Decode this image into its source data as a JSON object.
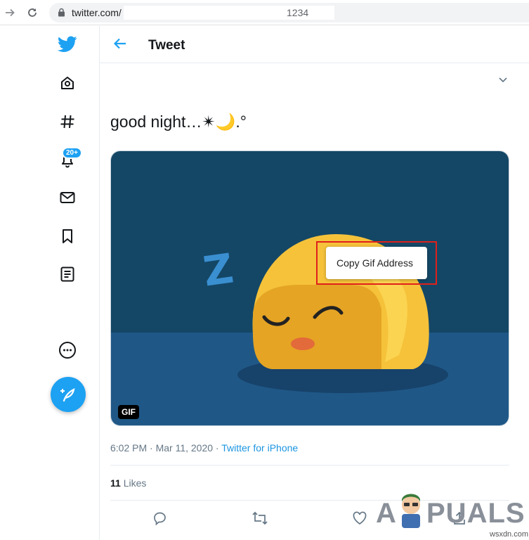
{
  "browser": {
    "url": "twitter.com/",
    "url_suffix": "1234"
  },
  "sidebar": {
    "notifications_badge": "20+"
  },
  "header": {
    "title": "Tweet"
  },
  "tweet": {
    "text": "good night…✴🌙.°",
    "gif_badge": "GIF",
    "time": "6:02 PM · Mar 11, 2020 · ",
    "source": "Twitter for iPhone",
    "likes_count": "11",
    "likes_label": "Likes"
  },
  "context_menu": {
    "item": "Copy Gif Address"
  },
  "gif_art": {
    "sleep_letter": "Z"
  },
  "watermark": {
    "brand_a": "A",
    "brand_rest": "PUALS",
    "site": "wsxdn.com"
  },
  "colors": {
    "accent": "#1da1f2",
    "highlight": "#e0201c",
    "gif_bg_top": "#144766",
    "gif_bg_bottom": "#1f5887"
  }
}
